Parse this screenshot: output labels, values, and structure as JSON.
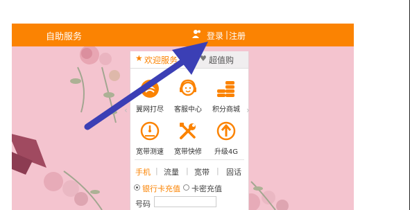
{
  "header": {
    "self_service": "自助服务",
    "login": "登录",
    "separator": "|",
    "register": "注册"
  },
  "panel": {
    "tab_welcome": "欢迎服务",
    "tab_super": "超值购",
    "tiles": [
      {
        "label": "翼网打尽",
        "icon": "wing-icon"
      },
      {
        "label": "客服中心",
        "icon": "headset-icon"
      },
      {
        "label": "积分商城",
        "icon": "coins-icon"
      },
      {
        "label": "宽带测速",
        "icon": "speedometer-icon"
      },
      {
        "label": "宽带快修",
        "icon": "wrench-icon"
      },
      {
        "label": "升级4G",
        "icon": "upgrade-icon"
      }
    ],
    "subtabs": [
      "手机",
      "流量",
      "宽带",
      "固话"
    ],
    "radio_bank": "银行卡充值",
    "radio_card": "卡密充值",
    "number_label": "号码"
  },
  "colors": {
    "accent": "#fb8302",
    "background": "#f4c4cf",
    "arrow": "#3b3fb5"
  }
}
